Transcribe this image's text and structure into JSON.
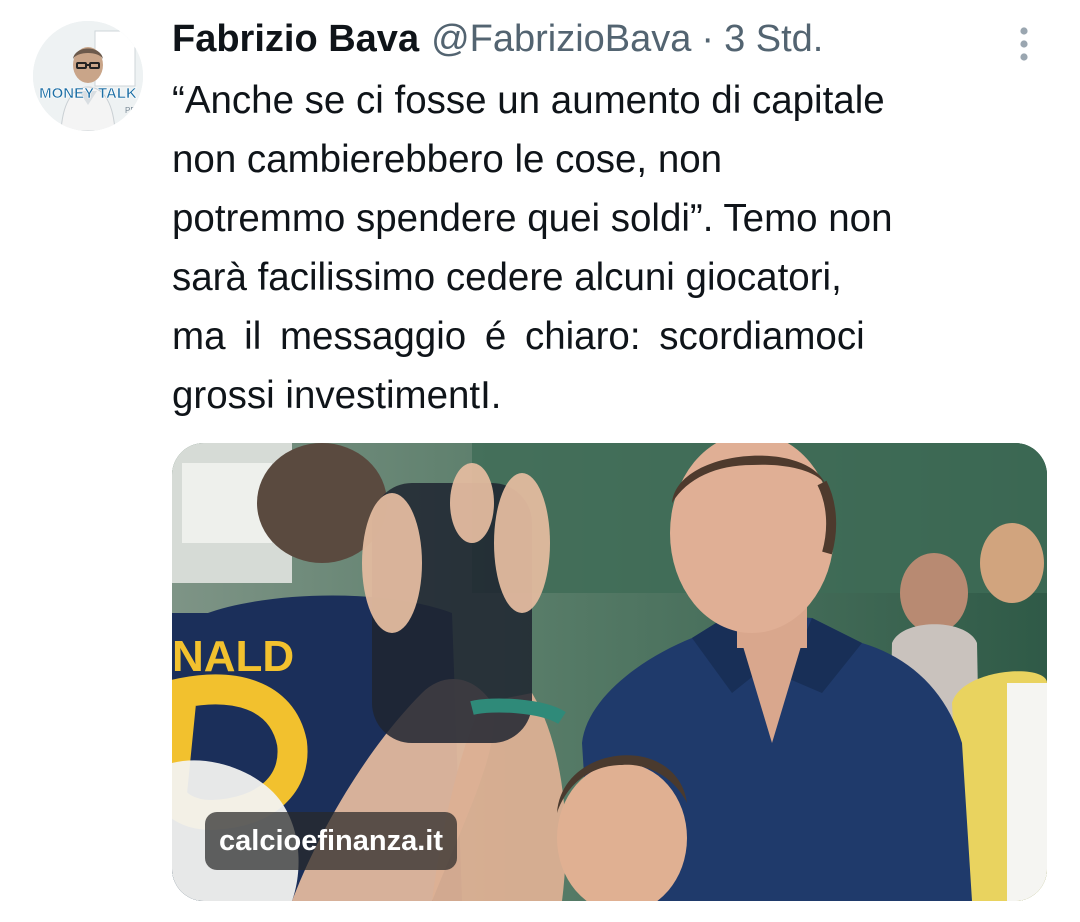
{
  "tweet": {
    "author": {
      "display_name": "Fabrizio Bava",
      "handle": "@FabrizioBava",
      "avatar_text": "MONEY TALK"
    },
    "separator": "·",
    "timestamp": "3 Std.",
    "text_lines": [
      "“Anche se ci fosse un aumento di capitale",
      "non cambierebbero le cose, non",
      "potremmo spendere quei soldi”. Temo non",
      "sarà facilissimo cedere alcuni  giocatori,",
      "ma il messaggio é chiaro: scordiamoci",
      "grossi  investimentI."
    ],
    "media": {
      "source_label": "calcioefinanza.it",
      "jersey_text": "NALD"
    }
  },
  "icons": {
    "more": "more-vertical-icon"
  },
  "colors": {
    "text_primary": "#0f1419",
    "text_secondary": "#536471",
    "shirt_navy": "#1f3a6b",
    "jersey_yellow": "#f2c12e"
  }
}
